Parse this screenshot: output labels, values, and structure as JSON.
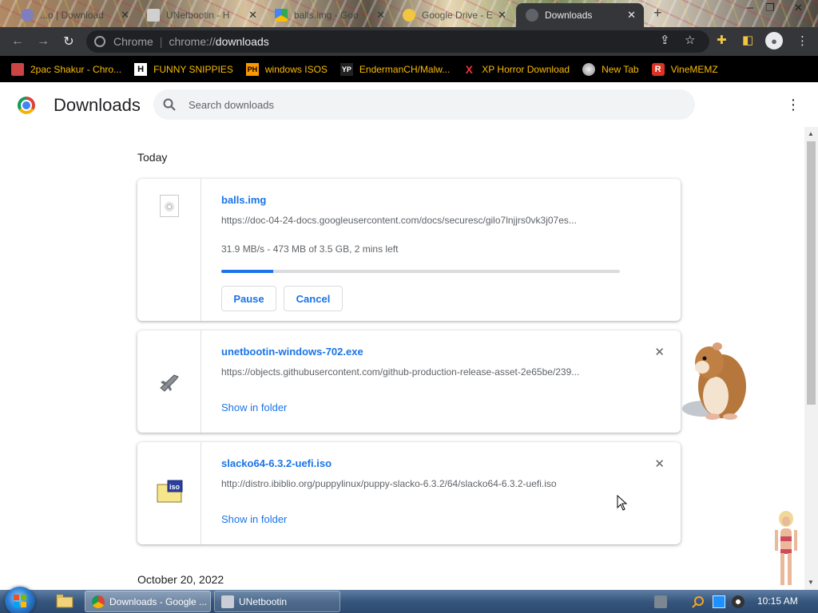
{
  "tabs": [
    {
      "label": "...o | Download",
      "active": false
    },
    {
      "label": "UNetbootin - H",
      "active": false
    },
    {
      "label": "balls.img - Goo",
      "active": false
    },
    {
      "label": "Google Drive - E",
      "active": false
    },
    {
      "label": "Downloads",
      "active": true
    }
  ],
  "toolbar": {
    "omnibox_site": "Chrome",
    "omnibox_scheme": "chrome://",
    "omnibox_host": "downloads"
  },
  "bookmarks": [
    {
      "label": "2pac Shakur - Chro...",
      "icon": "folder-icon"
    },
    {
      "label": "FUNNY SNIPPIES",
      "icon": "H"
    },
    {
      "label": "windows ISOS",
      "icon": "PH"
    },
    {
      "label": "EndermanCH/Malw...",
      "icon": "YP"
    },
    {
      "label": "XP Horror Download",
      "icon": "X"
    },
    {
      "label": "New Tab",
      "icon": "globe-icon"
    },
    {
      "label": "VineMEMZ",
      "icon": "R"
    }
  ],
  "page": {
    "title": "Downloads",
    "search_placeholder": "Search downloads"
  },
  "groups": [
    {
      "date": "Today"
    },
    {
      "date": "October 20, 2022"
    }
  ],
  "downloads": [
    {
      "name": "balls.img",
      "url": "https://doc-04-24-docs.googleusercontent.com/docs/securesc/gilo7lnjjrs0vk3j07es...",
      "status": "31.9 MB/s - 473 MB of 3.5 GB, 2 mins left",
      "progress": 0.13,
      "pause_label": "Pause",
      "cancel_label": "Cancel",
      "icon": "disk-image-icon"
    },
    {
      "name": "unetbootin-windows-702.exe",
      "url": "https://objects.githubusercontent.com/github-production-release-asset-2e65be/239...",
      "action": "Show in folder",
      "remove": "✕",
      "icon": "exe-icon"
    },
    {
      "name": "slacko64-6.3.2-uefi.iso",
      "url": "http://distro.ibiblio.org/puppylinux/puppy-slacko-6.3.2/64/slacko64-6.3.2-uefi.iso",
      "action": "Show in folder",
      "remove": "✕",
      "icon": "iso-icon"
    }
  ],
  "taskbar": {
    "tasks": [
      {
        "label": "Downloads - Google ...",
        "active": true
      },
      {
        "label": "UNetbootin",
        "active": false
      }
    ],
    "clock": "10:15 AM"
  },
  "colors": {
    "accent": "#1a73e8",
    "toolbar": "#35363a",
    "bookmark_text": "#fbbc04"
  }
}
